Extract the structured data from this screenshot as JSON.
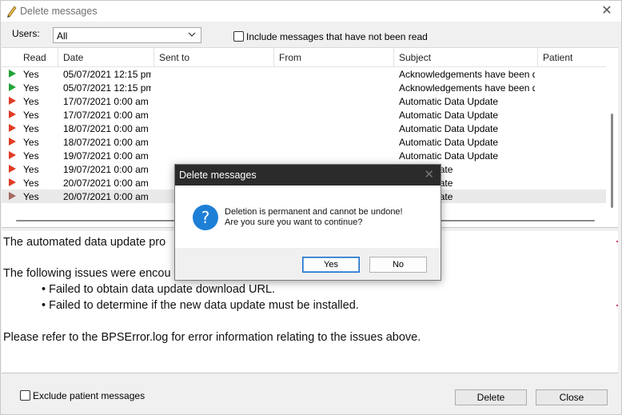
{
  "window": {
    "title": "Delete messages",
    "close_glyph": "✕"
  },
  "filters": {
    "users_label": "Users:",
    "users_value": "All",
    "include_unread_label": "Include messages that have not been read",
    "include_unread_checked": false
  },
  "grid": {
    "columns": [
      "Read",
      "Date",
      "Sent to",
      "From",
      "Subject",
      "Patient"
    ],
    "rows": [
      {
        "flag": "green",
        "read": "Yes",
        "date": "05/07/2021 12:15 pm",
        "sent_to": "",
        "from": "",
        "subject": "Acknowledgements have been di...",
        "patient": ""
      },
      {
        "flag": "green",
        "read": "Yes",
        "date": "05/07/2021 12:15 pm",
        "sent_to": "",
        "from": "",
        "subject": "Acknowledgements have been di...",
        "patient": ""
      },
      {
        "flag": "red",
        "read": "Yes",
        "date": "17/07/2021 0:00 am",
        "sent_to": "",
        "from": "",
        "subject": "Automatic Data Update",
        "patient": ""
      },
      {
        "flag": "red",
        "read": "Yes",
        "date": "17/07/2021 0:00 am",
        "sent_to": "",
        "from": "",
        "subject": "Automatic Data Update",
        "patient": ""
      },
      {
        "flag": "red",
        "read": "Yes",
        "date": "18/07/2021 0:00 am",
        "sent_to": "",
        "from": "",
        "subject": "Automatic Data Update",
        "patient": ""
      },
      {
        "flag": "red",
        "read": "Yes",
        "date": "18/07/2021 0:00 am",
        "sent_to": "",
        "from": "",
        "subject": "Automatic Data Update",
        "patient": ""
      },
      {
        "flag": "red",
        "read": "Yes",
        "date": "19/07/2021 0:00 am",
        "sent_to": "",
        "from": "",
        "subject": "Automatic Data Update",
        "patient": ""
      },
      {
        "flag": "red",
        "read": "Yes",
        "date": "19/07/2021 0:00 am",
        "sent_to": "",
        "from": "",
        "subject": "Data Update",
        "patient": ""
      },
      {
        "flag": "red",
        "read": "Yes",
        "date": "20/07/2021 0:00 am",
        "sent_to": "",
        "from": "",
        "subject": "Data Update",
        "patient": ""
      },
      {
        "flag": "dim",
        "read": "Yes",
        "date": "20/07/2021 0:00 am",
        "sent_to": "",
        "from": "",
        "subject": "Data Update",
        "patient": "",
        "selected": true
      }
    ]
  },
  "preview": {
    "line1": "The automated data update pro",
    "line2": "The following issues were encou",
    "bullet1": "• Failed to obtain data update download URL.",
    "bullet2": "• Failed to determine if the new data update must be installed.",
    "line3": "Please refer to the BPSError.log for error information relating to the issues above."
  },
  "footer": {
    "exclude_patient_label": "Exclude patient messages",
    "exclude_patient_checked": false,
    "delete_label": "Delete",
    "close_label": "Close"
  },
  "dialog": {
    "title": "Delete messages",
    "close_glyph": "✕",
    "icon": "question-icon",
    "icon_glyph": "?",
    "message_line1": "Deletion is permanent and cannot be undone!",
    "message_line2": "Are you sure you want to continue?",
    "yes_label": "Yes",
    "no_label": "No"
  },
  "colors": {
    "flag_green": "#21a437",
    "flag_red": "#e23b24",
    "dialog_title_bg": "#2b2b2b",
    "question_icon": "#1e7fd6"
  }
}
